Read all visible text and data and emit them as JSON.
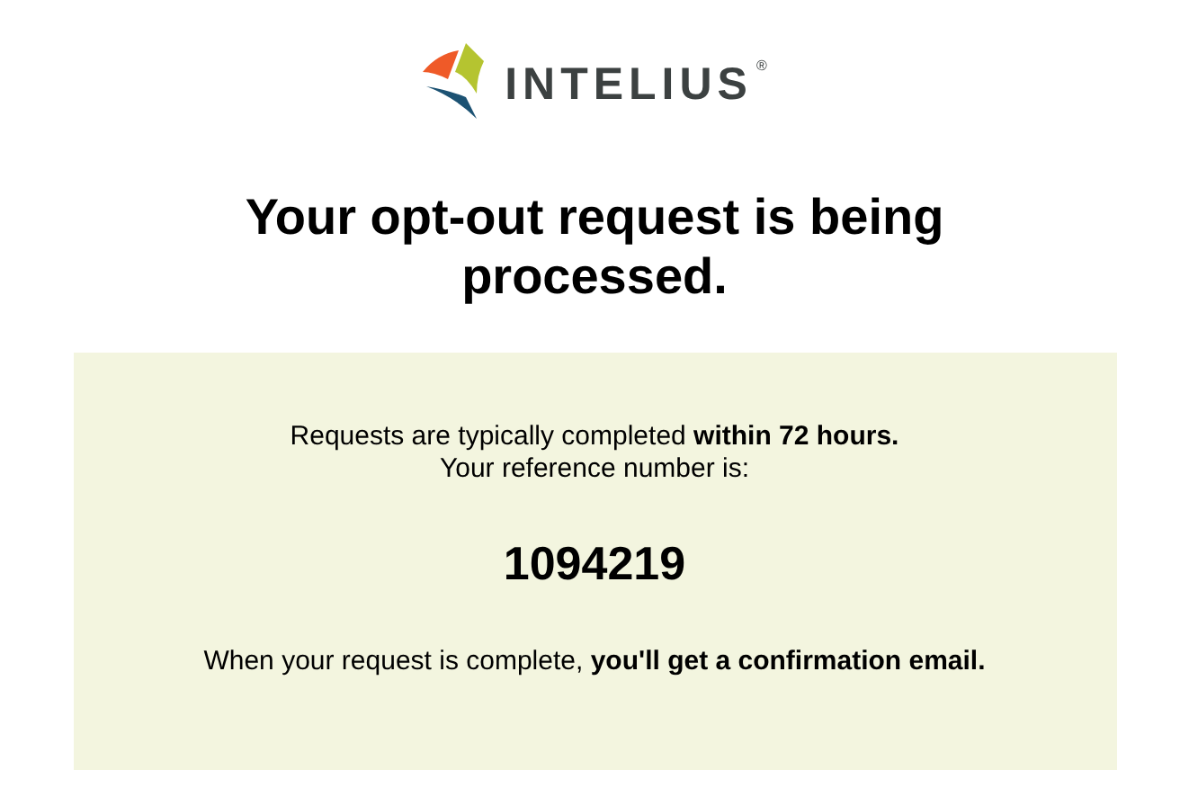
{
  "logo": {
    "name": "INTELIUS",
    "mark": "®"
  },
  "heading": "Your opt-out request is being processed.",
  "panel": {
    "line_1": "Requests are typically completed **within 72 hours.**",
    "line_2": "Your reference number is:",
    "reference_number": "1094219",
    "note": "When your request is complete, **you'll get a confirmation email.**"
  }
}
